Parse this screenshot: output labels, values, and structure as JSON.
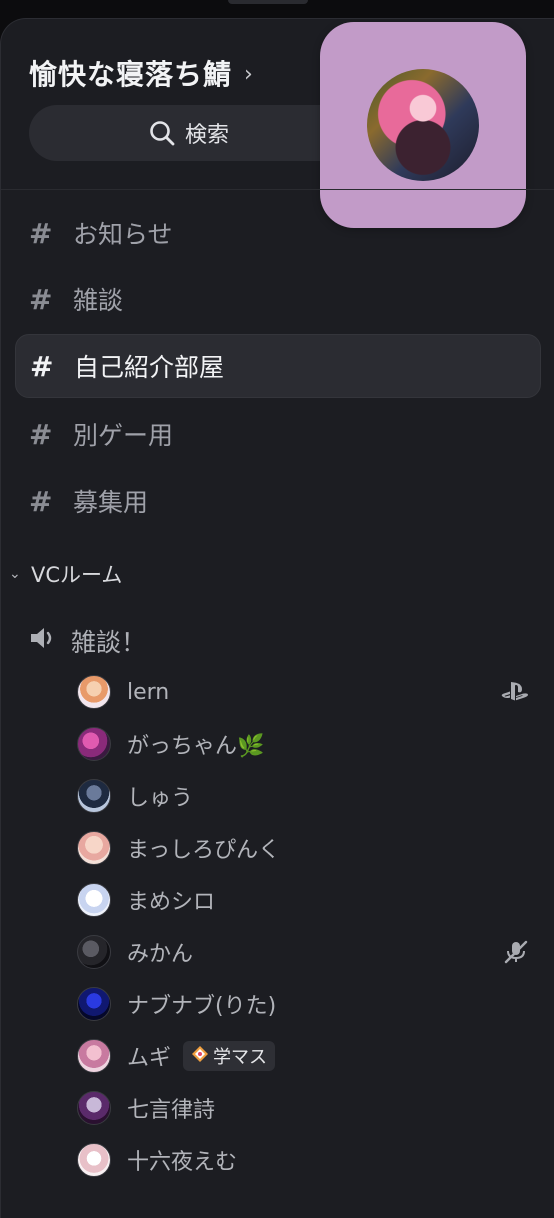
{
  "server": {
    "name": "愉快な寝落ち鯖",
    "chevron": "›",
    "search_label": "検索",
    "icon_bg": "#c29bc8"
  },
  "channels": [
    {
      "label": "お知らせ",
      "active": false
    },
    {
      "label": "雑談",
      "active": false
    },
    {
      "label": "自己紹介部屋",
      "active": true
    },
    {
      "label": "別ゲー用",
      "active": false
    },
    {
      "label": "募集用",
      "active": false
    }
  ],
  "channel_hash": "#",
  "category": {
    "label": "VCルーム",
    "chevron": "⌄"
  },
  "voice_channel": {
    "label": "雑談！",
    "icon": "speaker-icon"
  },
  "members": [
    {
      "name": "lern",
      "right_icon": "playstation-icon"
    },
    {
      "name": "がっちゃん🌿"
    },
    {
      "name": "しゅう"
    },
    {
      "name": "まっしろぴんく"
    },
    {
      "name": "まめシロ"
    },
    {
      "name": "みかん",
      "right_icon": "mic-muted-icon"
    },
    {
      "name": "ナブナブ(りた)"
    },
    {
      "name": "ムギ",
      "tag": "学マス",
      "tag_icon": "game-tag-icon"
    },
    {
      "name": "七言律詩"
    },
    {
      "name": "十六夜えむ"
    }
  ],
  "colors": {
    "background": "#1c1d22",
    "active_channel": "#2b2c32",
    "muted_text": "#9fa1a9"
  }
}
